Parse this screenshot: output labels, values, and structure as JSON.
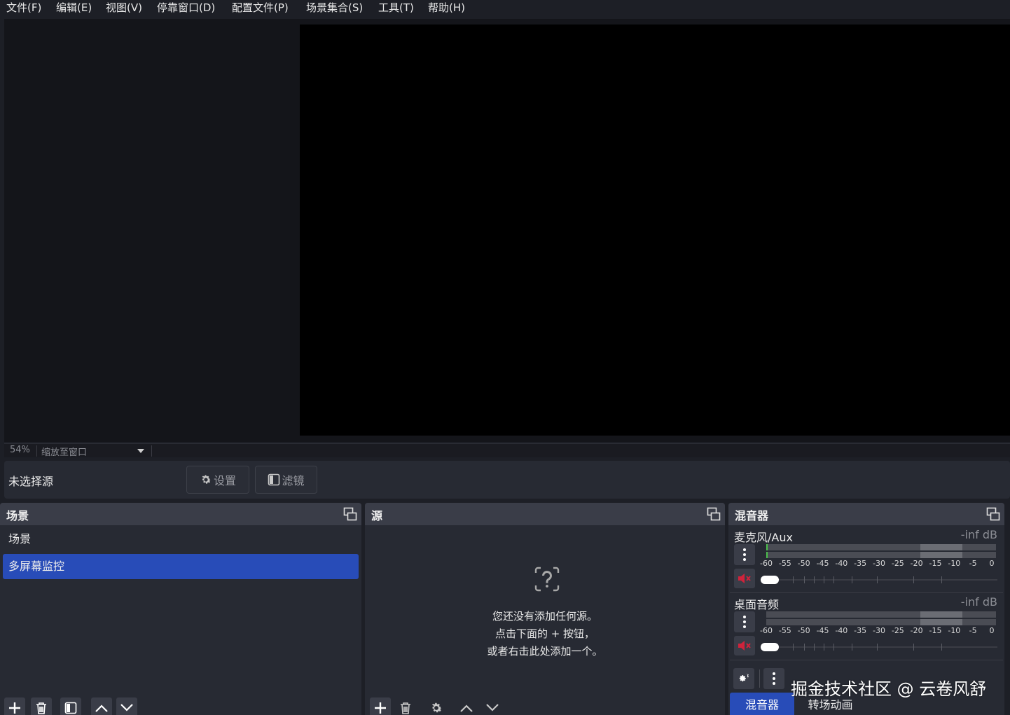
{
  "menu": {
    "file": "文件(F)",
    "edit": "编辑(E)",
    "view": "视图(V)",
    "docks": "停靠窗口(D)",
    "profile": "配置文件(P)",
    "scene_collection": "场景集合(S)",
    "tools": "工具(T)",
    "help": "帮助(H)"
  },
  "zoom": {
    "percent": "54%",
    "mode": "缩放至窗口"
  },
  "context": {
    "no_source": "未选择源",
    "properties_label": "设置",
    "filters_label": "滤镜"
  },
  "scenes": {
    "title": "场景",
    "items": [
      {
        "label": "场景",
        "selected": false
      },
      {
        "label": "多屏幕监控",
        "selected": true
      }
    ]
  },
  "sources": {
    "title": "源",
    "empty_lines": [
      "您还没有添加任何源。",
      "点击下面的 + 按钮，",
      "或者右击此处添加一个。"
    ]
  },
  "mixer": {
    "title": "混音器",
    "channels": [
      {
        "name": "麦克风/Aux",
        "db": "-inf dB",
        "muted": true,
        "volume_fraction": 0.0
      },
      {
        "name": "桌面音频",
        "db": "-inf dB",
        "muted": true,
        "volume_fraction": 0.0
      }
    ],
    "scale": [
      "-60",
      "-55",
      "-50",
      "-45",
      "-40",
      "-35",
      "-30",
      "-25",
      "-20",
      "-15",
      "-10",
      "-5",
      "0"
    ]
  },
  "tabs": {
    "mixer": "混音器",
    "transitions": "转场动画"
  },
  "watermark": "掘金技术社区 @ 云卷风舒",
  "colors": {
    "accent": "#284cb8",
    "mute": "#d0233b",
    "meter_green": "#4cc04c",
    "panel": "#272a33",
    "header": "#3a3d48"
  }
}
